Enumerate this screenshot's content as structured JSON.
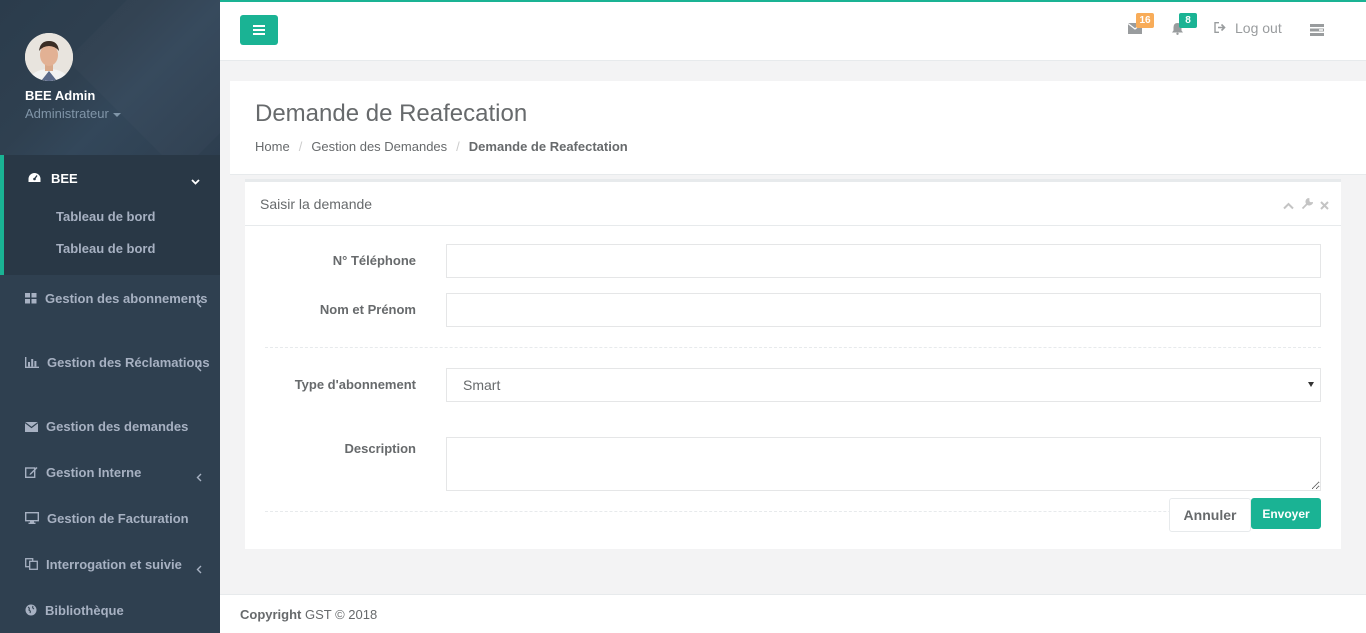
{
  "profile": {
    "name": "BEE Admin",
    "role": "Administrateur"
  },
  "sidebar": {
    "active": {
      "label": "BEE",
      "sub": [
        "Tableau de bord",
        "Tableau de bord"
      ]
    },
    "items": [
      {
        "label": "Gestion des abonnements",
        "icon": "th-large-icon"
      },
      {
        "label": "Gestion des Réclamations",
        "icon": "bar-chart-icon"
      },
      {
        "label": "Gestion des demandes",
        "icon": "envelope-icon"
      },
      {
        "label": "Gestion Interne",
        "icon": "edit-icon"
      },
      {
        "label": "Gestion de Facturation",
        "icon": "desktop-icon"
      },
      {
        "label": "Interrogation et suivie",
        "icon": "files-icon"
      },
      {
        "label": "Bibliothèque",
        "icon": "globe-icon"
      }
    ]
  },
  "topbar": {
    "mail_count": "16",
    "alert_count": "8",
    "logout_label": "Log out"
  },
  "page": {
    "title": "Demande de Reafecation",
    "breadcrumb": [
      "Home",
      "Gestion des Demandes",
      "Demande de Reafectation"
    ]
  },
  "form": {
    "title": "Saisir la demande",
    "phone_label": "N° Téléphone",
    "phone_value": "",
    "name_label": "Nom et Prénom",
    "name_value": "",
    "type_label": "Type d'abonnement",
    "type_value": "Smart",
    "desc_label": "Description",
    "desc_value": "",
    "cancel_label": "Annuler",
    "submit_label": "Envoyer"
  },
  "footer": {
    "copyright_label": "Copyright",
    "copyright_text": "GST © 2018"
  },
  "colors": {
    "accent": "#1ab394",
    "sidebar": "#2f4050",
    "warning": "#f8ac59"
  }
}
